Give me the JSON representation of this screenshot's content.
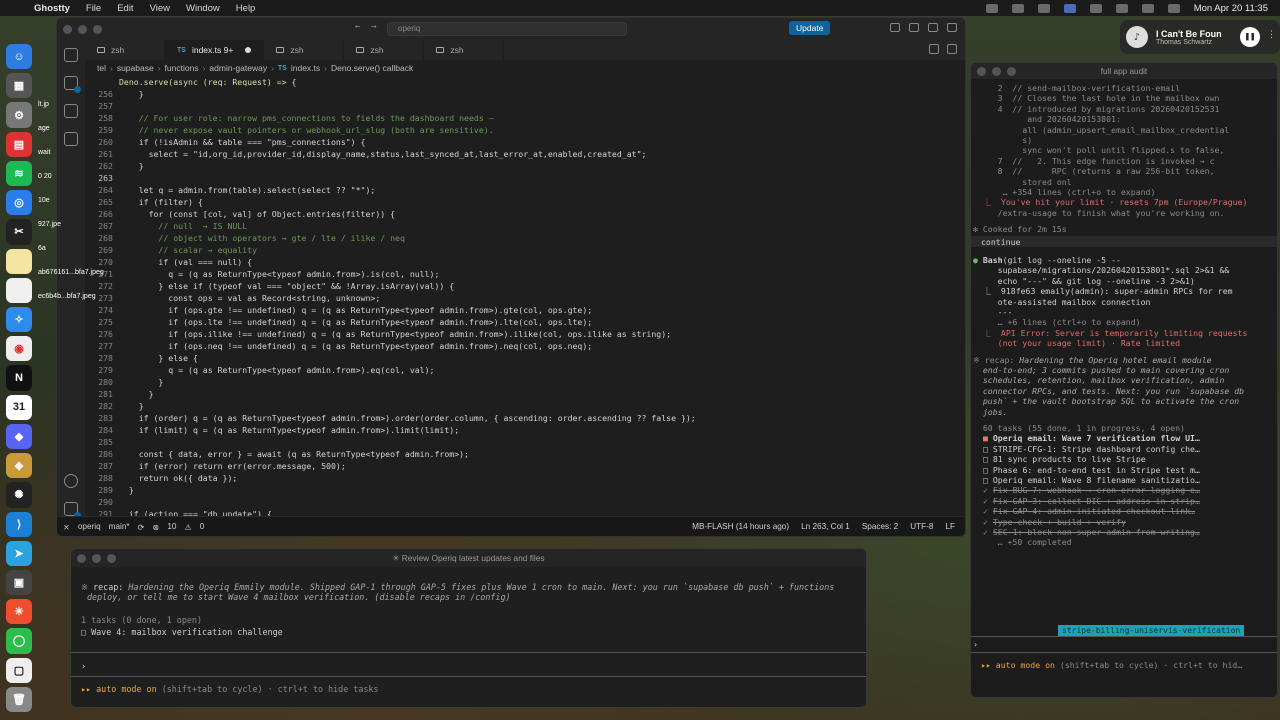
{
  "menubar": {
    "app": "Ghostty",
    "items": [
      "File",
      "Edit",
      "View",
      "Window",
      "Help"
    ],
    "datetime": "Mon Apr 20 11:35"
  },
  "now_playing": {
    "title": "I Can't Be Foun",
    "artist": "Thomas Schwartz"
  },
  "desktop_files": [
    "lt.jp",
    "age",
    "wait",
    "0 20",
    "10e",
    "927.jpe",
    "6a",
    "ab676161...bfa7.jpeg",
    "ec6b4b...bfa7.jpeg"
  ],
  "vscode": {
    "search": "operiq",
    "update_label": "Update",
    "tabs": [
      {
        "label": "zsh",
        "kind": "terminal",
        "active": false
      },
      {
        "label": "index.ts 9+",
        "kind": "ts",
        "active": true,
        "modified": true
      },
      {
        "label": "zsh",
        "kind": "terminal",
        "active": false
      },
      {
        "label": "zsh",
        "kind": "terminal",
        "active": false
      },
      {
        "label": "zsh",
        "kind": "terminal",
        "active": false
      }
    ],
    "breadcrumb": [
      "tel",
      "supabase",
      "functions",
      "admin-gateway",
      "index.ts",
      "Deno.serve() callback"
    ],
    "sticky_line": "Deno.serve(async (req: Request) => {",
    "status": {
      "remote": "operiq",
      "branch": "main*",
      "sync": "",
      "problems": "10",
      "warnings": "0",
      "flash": "MB-FLASH (14 hours ago)",
      "position": "Ln 263, Col 1",
      "spaces": "Spaces: 2",
      "encoding": "UTF-8",
      "eol": "LF"
    }
  },
  "code_lines": [
    {
      "n": "256",
      "t": "    }"
    },
    {
      "n": "257",
      "t": ""
    },
    {
      "n": "258",
      "t": "    // For user role: narrow pms_connections to fields the dashboard needs —"
    },
    {
      "n": "259",
      "t": "    // never expose vault pointers or webhook_url_slug (both are sensitive)."
    },
    {
      "n": "260",
      "t": "    if (!isAdmin && table === \"pms_connections\") {"
    },
    {
      "n": "261",
      "t": "      select = \"id,org_id,provider_id,display_name,status,last_synced_at,last_error_at,enabled,created_at\";"
    },
    {
      "n": "262",
      "t": "    }"
    },
    {
      "n": "263",
      "t": ""
    },
    {
      "n": "264",
      "t": "    let q = admin.from(table).select(select ?? \"*\");"
    },
    {
      "n": "265",
      "t": "    if (filter) {"
    },
    {
      "n": "266",
      "t": "      for (const [col, val] of Object.entries(filter)) {"
    },
    {
      "n": "267",
      "t": "        // null  → IS NULL"
    },
    {
      "n": "268",
      "t": "        // object with operators → gte / lte / ilike / neq"
    },
    {
      "n": "269",
      "t": "        // scalar → equality"
    },
    {
      "n": "270",
      "t": "        if (val === null) {"
    },
    {
      "n": "271",
      "t": "          q = (q as ReturnType<typeof admin.from>).is(col, null);"
    },
    {
      "n": "272",
      "t": "        } else if (typeof val === \"object\" && !Array.isArray(val)) {"
    },
    {
      "n": "273",
      "t": "          const ops = val as Record<string, unknown>;"
    },
    {
      "n": "274",
      "t": "          if (ops.gte !== undefined) q = (q as ReturnType<typeof admin.from>).gte(col, ops.gte);"
    },
    {
      "n": "275",
      "t": "          if (ops.lte !== undefined) q = (q as ReturnType<typeof admin.from>).lte(col, ops.lte);"
    },
    {
      "n": "276",
      "t": "          if (ops.ilike !== undefined) q = (q as ReturnType<typeof admin.from>).ilike(col, ops.ilike as string);"
    },
    {
      "n": "277",
      "t": "          if (ops.neq !== undefined) q = (q as ReturnType<typeof admin.from>).neq(col, ops.neq);"
    },
    {
      "n": "278",
      "t": "        } else {"
    },
    {
      "n": "279",
      "t": "          q = (q as ReturnType<typeof admin.from>).eq(col, val);"
    },
    {
      "n": "280",
      "t": "        }"
    },
    {
      "n": "281",
      "t": "      }"
    },
    {
      "n": "282",
      "t": "    }"
    },
    {
      "n": "283",
      "t": "    if (order) q = (q as ReturnType<typeof admin.from>).order(order.column, { ascending: order.ascending ?? false });"
    },
    {
      "n": "284",
      "t": "    if (limit) q = (q as ReturnType<typeof admin.from>).limit(limit);"
    },
    {
      "n": "285",
      "t": ""
    },
    {
      "n": "286",
      "t": "    const { data, error } = await (q as ReturnType<typeof admin.from>);"
    },
    {
      "n": "287",
      "t": "    if (error) return err(error.message, 500);"
    },
    {
      "n": "288",
      "t": "    return ok({ data });"
    },
    {
      "n": "289",
      "t": "  }"
    },
    {
      "n": "290",
      "t": ""
    },
    {
      "n": "291",
      "t": "  if (action === \"db_update\") {"
    }
  ],
  "terminal": {
    "title": "✳ Review Operiq latest updates and files",
    "recap_label": "recap:",
    "recap_text": "Hardening the Operiq Emmily module. Shipped GAP-1 through GAP-5 fixes plus Wave 1 cron to main. Next: you run `supabase db push` + functions",
    "recap_text2": "deploy, or tell me to start Wave 4 mailbox verification. (disable recaps in /config)",
    "tasks_summary": "1 tasks (0 done, 1 open)",
    "task_item": "□ Wave 4: mailbox verification challenge",
    "prompt": "›",
    "auto_mode_label": "▸▸ auto mode on",
    "auto_mode_hint": "(shift+tab to cycle) · ctrl+t to hide tasks"
  },
  "claude": {
    "title": "full app audit",
    "lines": [
      "     2  // send-mailbox-verification-email",
      "     3  // Closes the last hole in the mailbox own",
      "     4  // introduced by migrations 20260420152531",
      "           and 20260420153801:",
      "          all (admin_upsert_email_mailbox_credential",
      "          s)",
      "          sync won't poll until flipped.s to false,",
      "     7  //   2. This edge function is invoked → c",
      "     8  //      RPC (returns a raw 256-bit token,",
      "          stored onl",
      "      … +354 lines (ctrl+o to expand)"
    ],
    "limit_line1": "  ⎿  You've hit your limit · resets 7pm (Europe/Prague)",
    "limit_line2": "     /extra-usage to finish what you're working on.",
    "cooked": "✻ Cooked for 2m 15s",
    "continue": "continue",
    "bash_label": "Bash",
    "bash_lines": [
      "(git log --oneline -5 --",
      "     supabase/migrations/20260420153801*.sql 2>&1 &&",
      "     echo \"---\" && git log --oneline -3 2>&1)"
    ],
    "bash_out": [
      "  ⎿  918fe63 emaily(admin): super-admin RPCs for rem",
      "     ote-assisted mailbox connection",
      "     ---",
      "     … +6 lines (ctrl+o to expand)"
    ],
    "api_err1": "  ⎿  API Error: Server is temporarily limiting requests",
    "api_err2": "     (not your usage limit) · Rate limited",
    "recap_label": "※ recap:",
    "recap_lines": [
      " Hardening the Operiq hotel email module",
      "  end-to-end; 3 commits pushed to main covering cron",
      "  schedules, retention, mailbox verification, admin",
      "  connector RPCs, and tests. Next: you run `supabase db",
      "  push` + the vault bootstrap SQL to activate the cron",
      "  jobs."
    ],
    "tasks_summary": "  60 tasks (55 done, 1 in progress, 4 open)",
    "tasks": [
      {
        "mark": "■",
        "text": "Operiq email: Wave 7 verification flow UI…",
        "state": "progress"
      },
      {
        "mark": "□",
        "text": "STRIPE-CFG-1: Stripe dashboard config che…",
        "state": "open"
      },
      {
        "mark": "□",
        "text": "81 sync products to live Stripe",
        "state": "open"
      },
      {
        "mark": "□",
        "text": "Phase 6: end-to-end test in Stripe test m…",
        "state": "open"
      },
      {
        "mark": "□",
        "text": "Operiq email: Wave 8 filename sanitizatio…",
        "state": "open"
      },
      {
        "mark": "✓",
        "text": "Fix BUG-7: webhook → cron error logging e…",
        "state": "done"
      },
      {
        "mark": "✓",
        "text": "Fix GAP-3: collect DIC + address in strip…",
        "state": "done"
      },
      {
        "mark": "✓",
        "text": "Fix GAP-4: admin-initiated checkout link…",
        "state": "done"
      },
      {
        "mark": "✓",
        "text": "Type-check + build + verify",
        "state": "done"
      },
      {
        "mark": "✓",
        "text": "SEC-1: block non-super-admin from writing…",
        "state": "done"
      }
    ],
    "completed": "     … +50 completed",
    "badge": "stripe-billing-uniservis-verification",
    "prompt": "›",
    "auto_mode_label": "▸▸ auto mode on",
    "auto_mode_hint": "(shift+tab to cycle) · ctrl+t to hid…"
  }
}
